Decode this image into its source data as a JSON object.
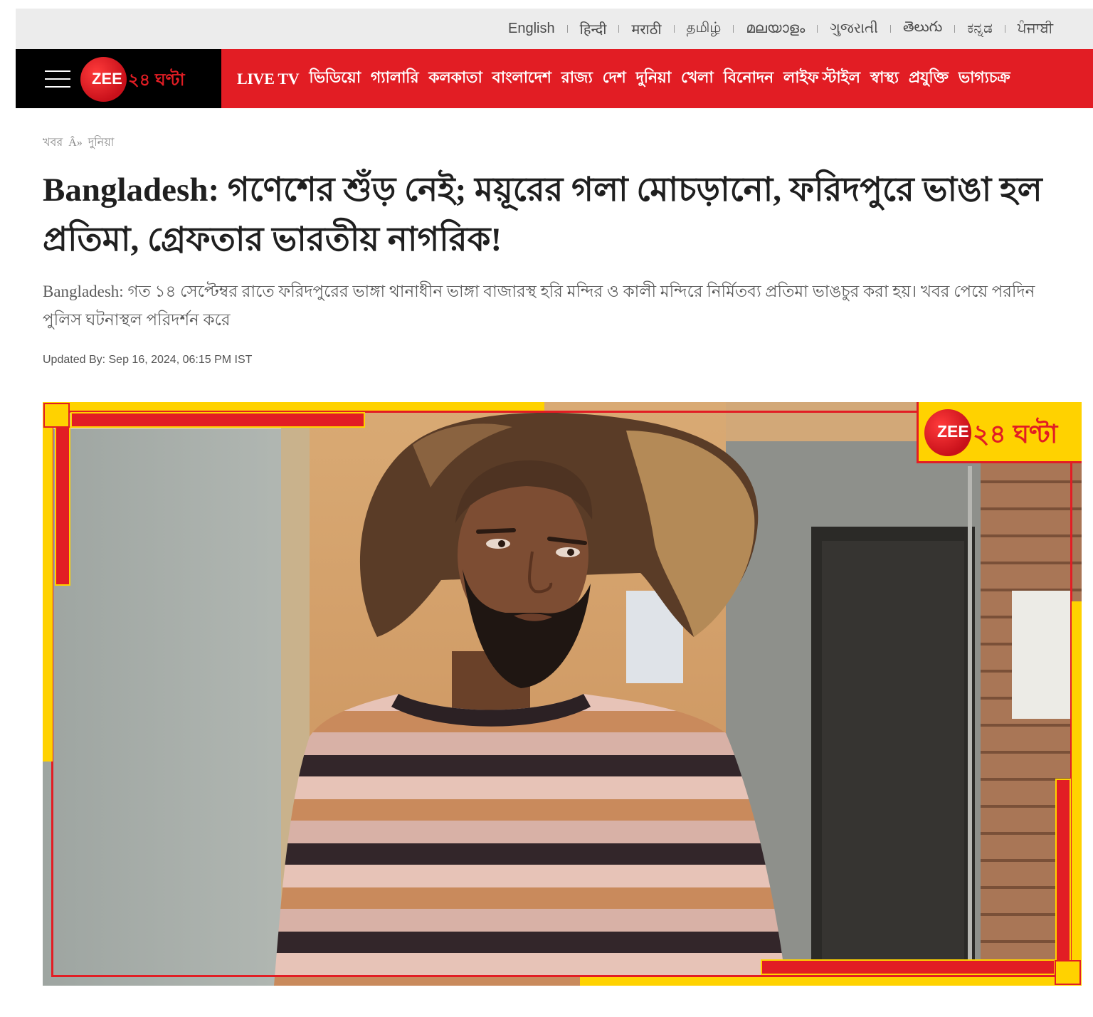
{
  "header": {
    "languages": [
      "English",
      "हिन्दी",
      "मराठी",
      "தமிழ்",
      "മലയാളം",
      "ગુજરાતી",
      "తెలుగు",
      "ಕನ್ನಡ",
      "ਪੰਜਾਬੀ"
    ],
    "menu_icon": "hamburger-menu-icon",
    "logo": {
      "zee": "ZEE",
      "brand": "২৪ ঘণ্টা"
    },
    "nav": [
      "LIVE TV",
      "ভিডিয়ো",
      "গ্যালারি",
      "কলকাতা",
      "বাংলাদেশ",
      "রাজ্য",
      "দেশ",
      "দুনিয়া",
      "খেলা",
      "বিনোদন",
      "লাইফ স্টাইল",
      "স্বাস্থ্য",
      "প্রযুক্তি",
      "ভাগ্যচক্র"
    ]
  },
  "breadcrumb": {
    "home": "খবর",
    "separator": "Â»",
    "section": "দুনিয়া"
  },
  "article": {
    "headline": "Bangladesh: গণেশের শুঁড় নেই; ময়ূরের গলা মোচড়ানো, ফরিদপুরে ভাঙা হল প্রতিমা, গ্রেফতার ভারতীয় নাগরিক!",
    "summary": "Bangladesh: গত ১৪ সেপ্টেম্বর রাতে ফরিদপুরের ভাঙ্গা থানাধীন ভাঙ্গা বাজারস্থ হরি মন্দির ও কালী মন্দিরে নির্মিতব্য প্রতিমা ভাঙচুর করা হয়। খবর পেয়ে পরদিন পুলিস ঘটনাস্থল পরিদর্শন করে",
    "updated": "Updated By: Sep 16, 2024, 06:15 PM IST",
    "image_watermark": {
      "zee": "ZEE",
      "brand": "২৪ ঘণ্টা"
    }
  },
  "colors": {
    "brand_red": "#e21d24",
    "nav_black": "#000000",
    "watermark_yellow": "#ffd200",
    "topbar_grey": "#ececec"
  }
}
